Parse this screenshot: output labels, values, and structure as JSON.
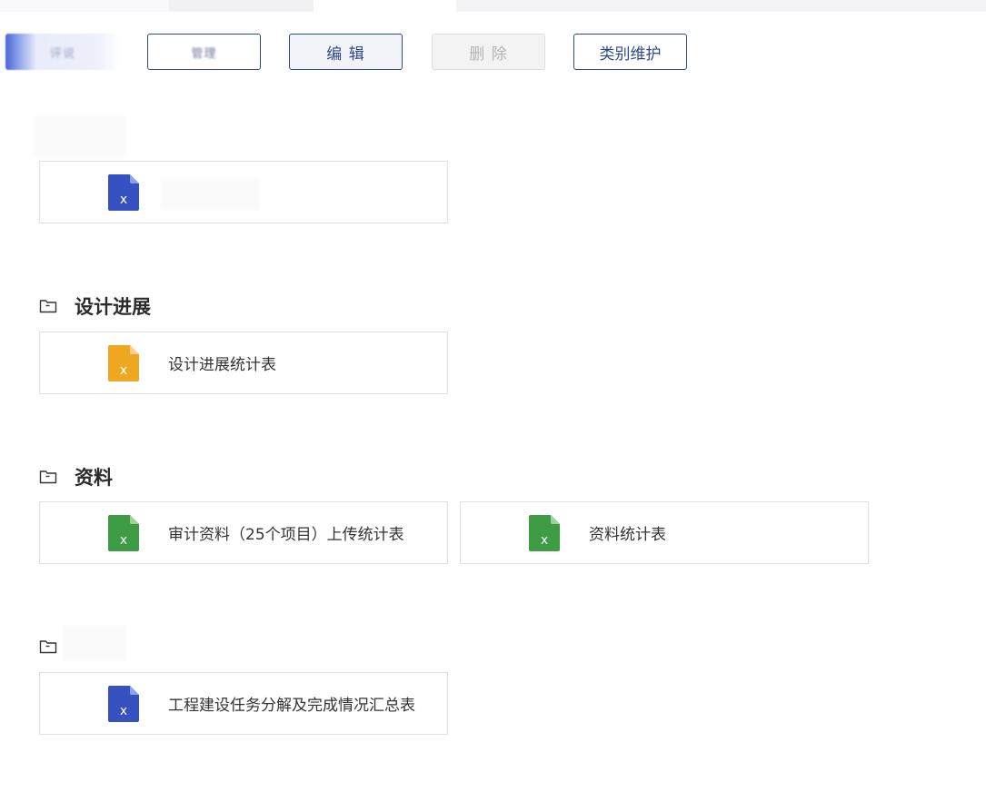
{
  "toolbar": {
    "blurred_button_1_label": "评说",
    "blurred_button_2_label": "管理",
    "edit_label": "编 辑",
    "delete_label": "删 除",
    "category_label": "类别维护"
  },
  "sections": [
    {
      "title": "",
      "files": [
        {
          "name": "",
          "icon_color": "#3552c0"
        }
      ]
    },
    {
      "title": "设计进展",
      "files": [
        {
          "name": "设计进展统计表",
          "icon_color": "#f0a822"
        }
      ]
    },
    {
      "title": "资料",
      "files": [
        {
          "name": "审计资料（25个项目）上传统计表",
          "icon_color": "#3e9c45"
        },
        {
          "name": "资料统计表",
          "icon_color": "#3e9c45"
        }
      ]
    },
    {
      "title": "",
      "files": [
        {
          "name": "工程建设任务分解及完成情况汇总表",
          "icon_color": "#3552c0"
        }
      ]
    }
  ],
  "icons": {
    "file": "excel-file-icon",
    "folder": "folder-icon"
  }
}
